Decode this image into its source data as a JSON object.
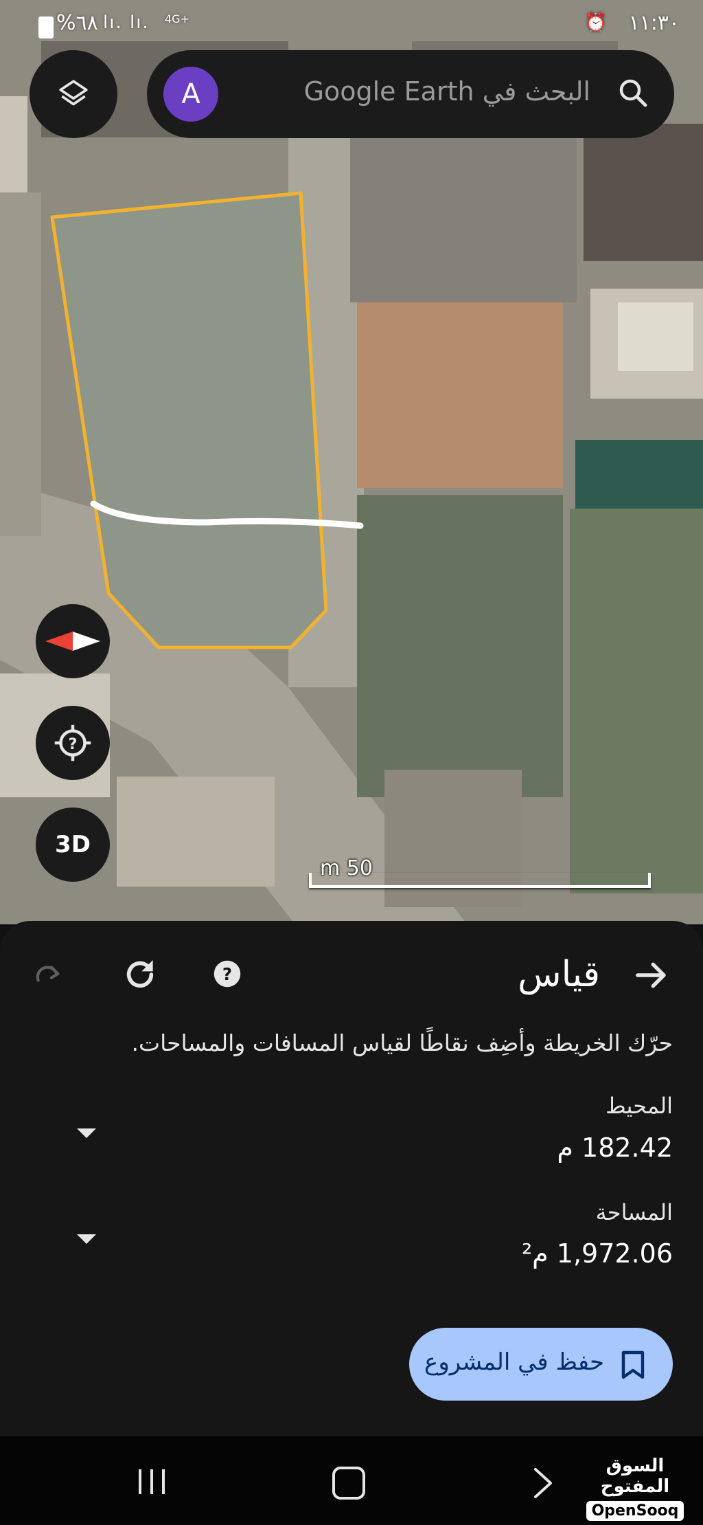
{
  "status_bar": {
    "time": "١١:٣٠",
    "alarm_icon": "alarm-lock-icon",
    "battery": "%٦٨",
    "signal": "lı. lı.",
    "network": "4G+"
  },
  "search": {
    "avatar_letter": "A",
    "placeholder": "البحث في Google Earth",
    "layers_icon": "layers-icon",
    "search_icon": "search-icon"
  },
  "map_controls": {
    "compass_icon": "compass-icon",
    "location_icon": "my-location-icon",
    "view_3d_label": "3D"
  },
  "scale": {
    "label": "m 50"
  },
  "measure": {
    "title": "قياس",
    "instruction": "حرّك الخريطة وأضِف نقاطًا لقياس المسافات والمساحات.",
    "perimeter": {
      "label": "المحيط",
      "value": "182.42 م"
    },
    "area": {
      "label": "المساحة",
      "value": "1,972.06 م²"
    },
    "save_button": "حفظ في المشروع"
  },
  "watermark": {
    "arabic": "السوق المفتوح",
    "english": "OpenSooq"
  },
  "colors": {
    "polygon": "#f2b230",
    "sheet_bg": "#161616",
    "save_button_bg": "#a8c7fa",
    "avatar_bg": "#6a3fc1"
  }
}
